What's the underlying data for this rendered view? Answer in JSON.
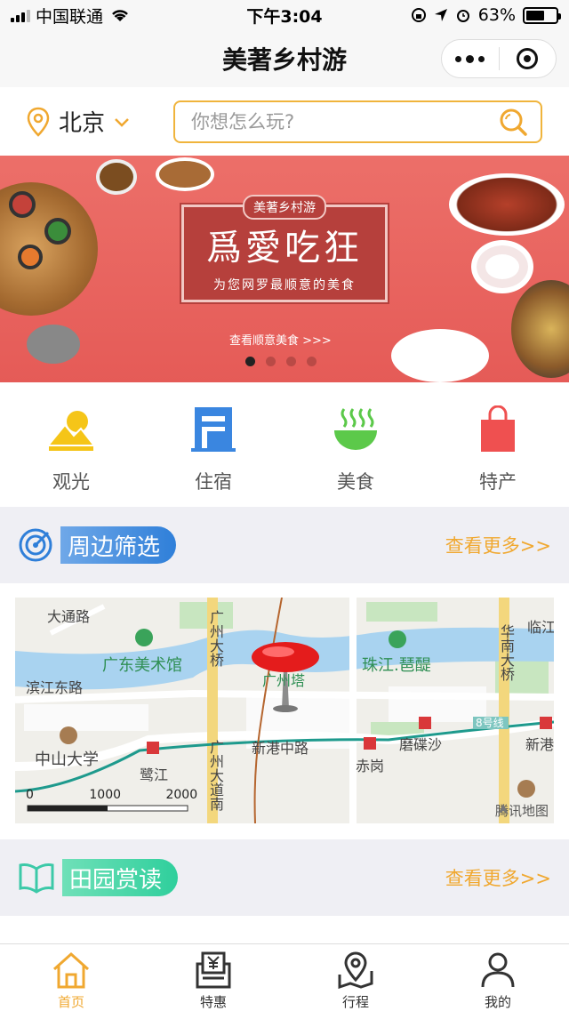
{
  "status_bar": {
    "carrier": "中国联通",
    "time": "下午3:04",
    "battery_percent": "63%",
    "battery_level": 0.63
  },
  "nav": {
    "title": "美著乡村游"
  },
  "location": {
    "city": "北京"
  },
  "search": {
    "placeholder": "你想怎么玩?"
  },
  "banner": {
    "tag": "美著乡村游",
    "headline": "爲愛吃狂",
    "subtitle": "为您网罗最顺意的美食",
    "link": "查看顺意美食 >>>",
    "active_index": 0,
    "count": 4
  },
  "categories": [
    {
      "label": "观光",
      "icon": "sightseeing-icon",
      "color": "#f5c518"
    },
    {
      "label": "住宿",
      "icon": "lodging-icon",
      "color": "#3a86e0"
    },
    {
      "label": "美食",
      "icon": "food-bowl-icon",
      "color": "#5cc94a"
    },
    {
      "label": "特产",
      "icon": "shopping-bag-icon",
      "color": "#ef5050"
    }
  ],
  "section_nearby": {
    "title": "周边筛选",
    "more": "查看更多>>",
    "icon": "radar-icon",
    "color": "#2f7fd9"
  },
  "map": {
    "labels": {
      "dalu": "大通路",
      "guangdong_museum": "广东美术馆",
      "binjiang": "滨江东路",
      "zhongshan": "中山大学",
      "lujiang": "鹭江",
      "xingang_zhong": "新港中路",
      "chigang": "赤岗",
      "mochasha": "磨碟沙",
      "xingang": "新港",
      "zhujiang": "珠江.琶醍",
      "line8": "8号线",
      "linjiang": "临江",
      "guangzhou_bridge": "广州大桥",
      "guangzhou_road": "广州大道南",
      "huanan_bridge": "华南大桥",
      "tower": "广州塔"
    },
    "scale": [
      "0",
      "1000",
      "2000"
    ],
    "attribution": "腾讯地图"
  },
  "section_read": {
    "title": "田园赏读",
    "more": "查看更多>>",
    "icon": "open-book-icon",
    "color": "#3cc9a8"
  },
  "tabs": [
    {
      "label": "首页",
      "icon": "home-icon",
      "active": true
    },
    {
      "label": "特惠",
      "icon": "discount-icon",
      "active": false
    },
    {
      "label": "行程",
      "icon": "map-pin-icon",
      "active": false
    },
    {
      "label": "我的",
      "icon": "user-icon",
      "active": false
    }
  ],
  "colors": {
    "accent": "#f0a830",
    "search_border": "#f0b43c",
    "banner_bg": "#e8615c"
  }
}
